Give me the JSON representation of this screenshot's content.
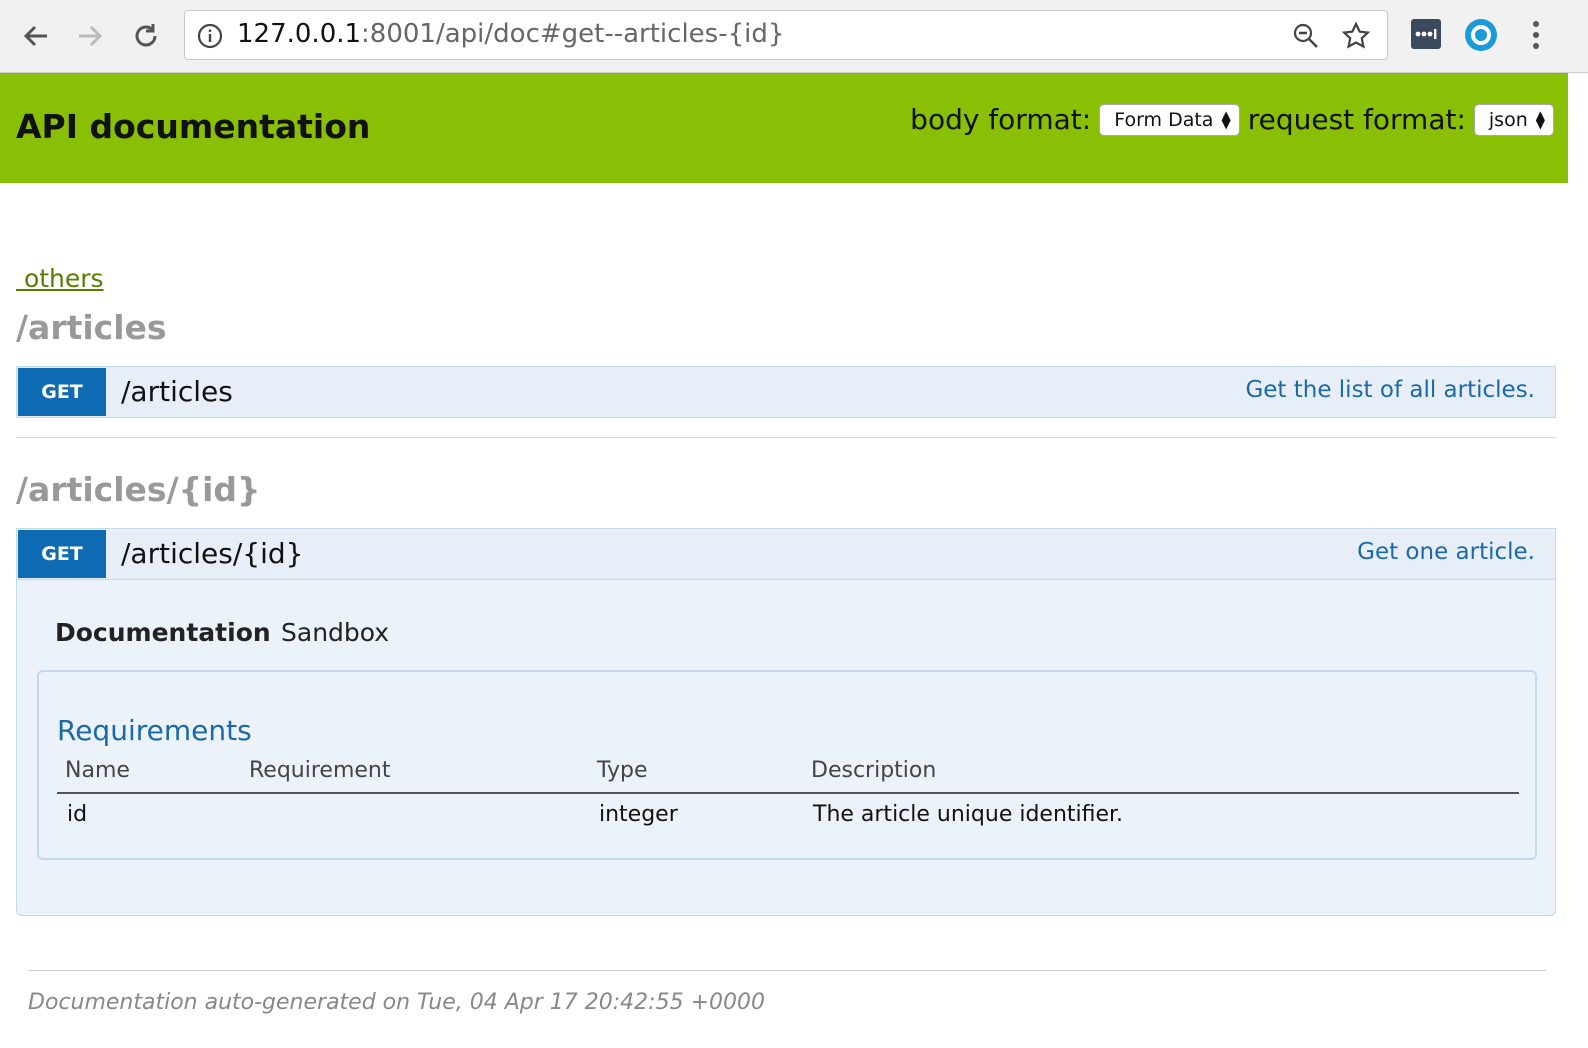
{
  "browser": {
    "url_host": "127.0.0.1",
    "url_rest": ":8001/api/doc#get--articles-{id}"
  },
  "header": {
    "title": "API documentation",
    "body_format_label": "body format:",
    "body_format_value": "Form Data",
    "request_format_label": "request format:",
    "request_format_value": "json"
  },
  "nav": {
    "others_link": " others"
  },
  "sections": [
    {
      "heading": "/articles",
      "method": "GET",
      "path": "/articles",
      "description": "Get the list of all articles."
    },
    {
      "heading": "/articles/{id}",
      "method": "GET",
      "path": "/articles/{id}",
      "description": "Get one article."
    }
  ],
  "detail": {
    "tabs": [
      "Documentation",
      "Sandbox"
    ],
    "requirements_title": "Requirements",
    "columns": [
      "Name",
      "Requirement",
      "Type",
      "Description"
    ],
    "rows": [
      {
        "name": "id",
        "requirement": "",
        "type": "integer",
        "description": "The article unique identifier."
      }
    ]
  },
  "footer": {
    "text": "Documentation auto-generated on Tue, 04 Apr 17 20:42:55 +0000"
  },
  "colors": {
    "header_bg": "#89bf04",
    "get_badge": "#0f6ab4",
    "link_blue": "#1a6aa8"
  }
}
